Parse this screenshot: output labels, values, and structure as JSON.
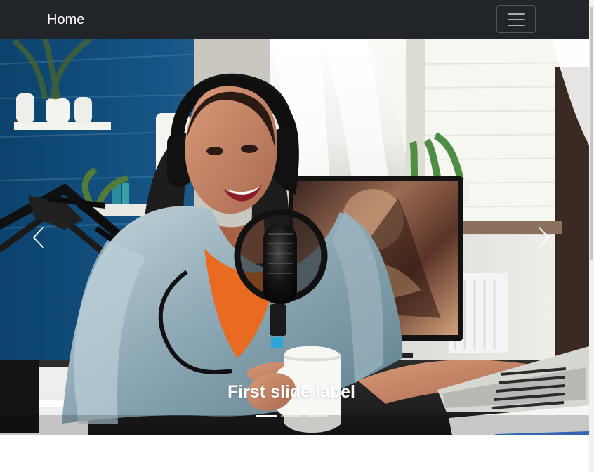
{
  "navbar": {
    "brand": "Home",
    "menu_icon": "hamburger-icon"
  },
  "carousel": {
    "caption": "First slide label",
    "active_index": 0,
    "slide_count": 3,
    "controls": {
      "previous_icon": "chevron-left-icon",
      "next_icon": "chevron-right-icon"
    }
  },
  "colors": {
    "navbar_background": "#212529",
    "page_background": "#ffffff",
    "indicator_active": "#ffffff",
    "indicator_inactive": "#b7b7b7"
  }
}
